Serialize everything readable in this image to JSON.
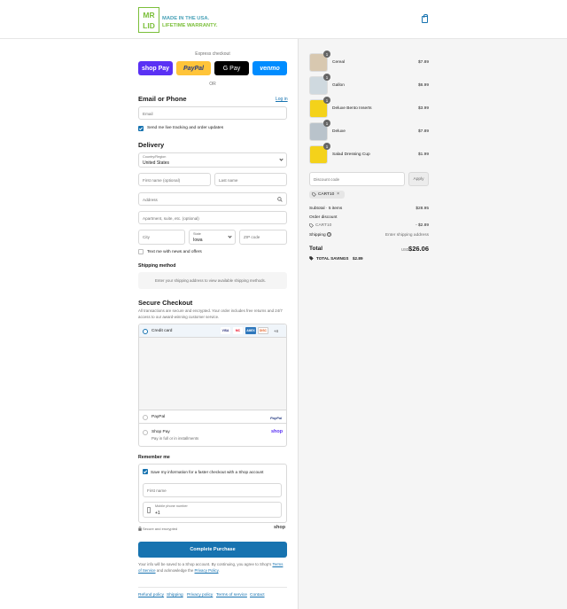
{
  "brand": {
    "logo_mark": "MR LID",
    "tagline1": "MADE IN THE USA.",
    "tagline2": "LIFETIME WARRANTY."
  },
  "express": {
    "label": "Express checkout",
    "buttons": [
      {
        "label": "shop Pay",
        "bg": "#5a31f4",
        "fg": "#ffffff"
      },
      {
        "label": "PayPal",
        "bg": "#ffc439",
        "fg": "#253b80"
      },
      {
        "label": "G Pay",
        "bg": "#000000",
        "fg": "#ffffff"
      },
      {
        "label": "venmo",
        "bg": "#008cff",
        "fg": "#ffffff"
      }
    ],
    "or": "OR"
  },
  "contact": {
    "title": "Email or Phone",
    "login": "Log in",
    "email_placeholder": "Email",
    "tracking_label": "Send me live tracking and order updates"
  },
  "delivery": {
    "title": "Delivery",
    "country_label": "Country/Region",
    "country_value": "United States",
    "first_name": "First name (optional)",
    "last_name": "Last name",
    "address": "Address",
    "apartment": "Apartment, suite, etc. (optional)",
    "city": "City",
    "state_label": "State",
    "state_value": "Iowa",
    "zip": "ZIP code",
    "news_label": "Text me with news and offers"
  },
  "shipping": {
    "title": "Shipping method",
    "message": "Enter your shipping address to view available shipping methods."
  },
  "payment": {
    "title": "Secure Checkout",
    "desc": "All transactions are secure and encrypted. Your order includes free returns and 24/7 access to our award-winning customer service.",
    "credit_card": "Credit card",
    "cards": [
      {
        "label": "VISA",
        "bg": "#ffffff",
        "fg": "#1a1f71"
      },
      {
        "label": "MC",
        "bg": "#ffffff",
        "fg": "#eb001b"
      },
      {
        "label": "AMEX",
        "bg": "#2e77bc",
        "fg": "#ffffff"
      },
      {
        "label": "DISC",
        "bg": "#ffffff",
        "fg": "#e55c20"
      }
    ],
    "more_cards": "+4",
    "paypal": "PayPal",
    "paypal_logo": "PayPal",
    "shop_pay": "Shop Pay",
    "shop_pay_sub": "Pay in full or in installments",
    "shop_logo": "shop"
  },
  "remember": {
    "title": "Remember me",
    "save_label": "Save my information for a faster checkout with a Shop account",
    "first_name": "First name",
    "phone_label": "Mobile phone number",
    "phone_value": "+1",
    "secure": "Secure and encrypted",
    "shop_logo": "shop"
  },
  "complete_button": "Complete Purchase",
  "legal": {
    "text": "Your info will be saved to a Shop account. By continuing, you agree to Shop's",
    "terms": "Terms of Service",
    "and": "and acknowledge the",
    "privacy": "Privacy Policy",
    "end": "."
  },
  "footer": [
    "Refund policy",
    "Shipping",
    "Privacy policy",
    "Terms of service",
    "Contact"
  ],
  "cart": {
    "items": [
      {
        "name": "Cereal",
        "qty": "1",
        "price": "$7.89",
        "color": "#d8c8b0"
      },
      {
        "name": "Gallon",
        "qty": "1",
        "price": "$6.99",
        "color": "#cfd9df"
      },
      {
        "name": "Deluxe Bento Inserts",
        "qty": "1",
        "price": "$3.99",
        "color": "#f4d21a"
      },
      {
        "name": "Deluxe",
        "qty": "1",
        "price": "$7.89",
        "color": "#b9c3cb"
      },
      {
        "name": "Salad Dressing Cup",
        "qty": "1",
        "price": "$1.99",
        "color": "#f4d21a"
      }
    ],
    "discount_placeholder": "Discount code",
    "apply": "Apply",
    "code": "CART10",
    "subtotal_label": "Subtotal · 5 items",
    "subtotal_value": "$28.95",
    "order_discount_label": "Order discount",
    "discount_code": "CART10",
    "discount_value": "- $2.89",
    "shipping_label": "Shipping",
    "shipping_value": "Enter shipping address",
    "total_label": "Total",
    "currency": "USD",
    "total_value": "$26.06",
    "savings_label": "TOTAL SAVINGS",
    "savings_value": "$2.89"
  }
}
